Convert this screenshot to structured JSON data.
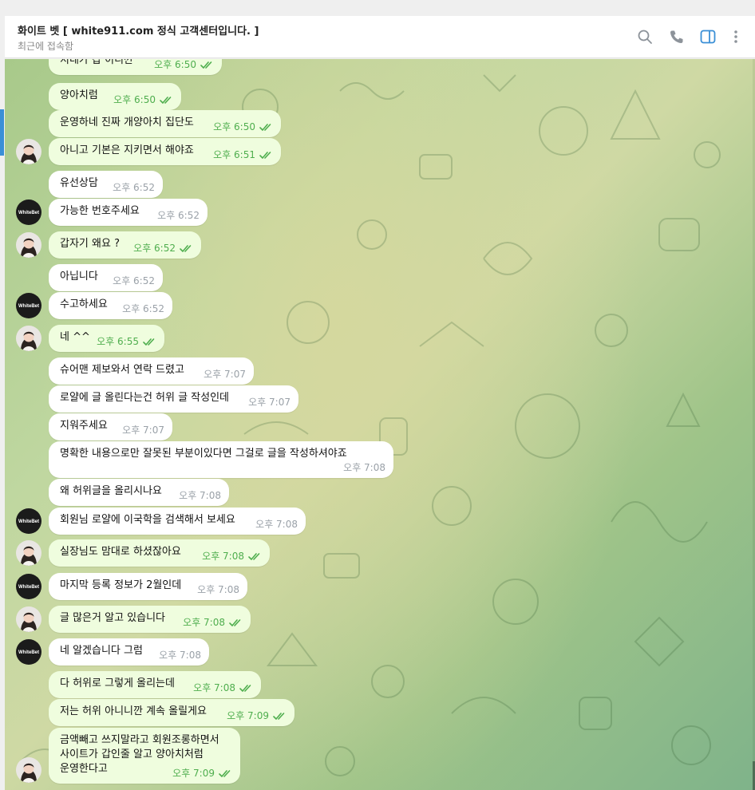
{
  "header": {
    "title": "화이트 벳 [ white911.com 정식 고객센터입니다. ]",
    "status": "최근에 접속함",
    "icons": [
      "search-icon",
      "phone-icon",
      "sidebar-toggle-icon",
      "more-icon"
    ]
  },
  "colors": {
    "accent": "#3a8fd6",
    "out_bubble": "#effdde",
    "in_bubble": "#ffffff",
    "read_tick": "#4fae4e"
  },
  "avatars": {
    "user": "woman-photo",
    "agent": "whitebet-logo"
  },
  "agent_logo_text": "WhiteBet",
  "messages": [
    {
      "text": "지네가 갑 이니깐",
      "time": "오후 6:50",
      "out": true
    },
    {
      "text": "양아치럼",
      "time": "오후 6:50",
      "out": true
    },
    {
      "text": "운영하네 진짜 개양아치 집단도",
      "time": "오후 6:50",
      "out": true
    },
    {
      "text": "아니고 기본은 지키면서 해야죠",
      "time": "오후 6:51",
      "out": true
    },
    {
      "text": "유선상담",
      "time": "오후 6:52",
      "out": false
    },
    {
      "text": "가능한 번호주세요",
      "time": "오후 6:52",
      "out": false
    },
    {
      "text": "갑자기 왜요 ?",
      "time": "오후 6:52",
      "out": true
    },
    {
      "text": "아닙니다",
      "time": "오후 6:52",
      "out": false
    },
    {
      "text": "수고하세요",
      "time": "오후 6:52",
      "out": false
    },
    {
      "text": "네 ^^",
      "time": "오후 6:55",
      "out": true
    },
    {
      "text": "슈어맨 제보와서 연락 드렸고",
      "time": "오후 7:07",
      "out": false
    },
    {
      "text": "로얄에 글 올린다는건 허위 글 작성인데",
      "time": "오후 7:07",
      "out": false
    },
    {
      "text": "지워주세요",
      "time": "오후 7:07",
      "out": false
    },
    {
      "text": "명확한 내용으로만 잘못된 부분이있다면 그걸로 글을 작성하셔야죠",
      "time": "오후 7:08",
      "out": false
    },
    {
      "text": "왜 허위글을 올리시나요",
      "time": "오후 7:08",
      "out": false
    },
    {
      "text": "회원님 로얄에 이국학을 검색해서 보세요",
      "time": "오후 7:08",
      "out": false
    },
    {
      "text": "실장님도 맘대로 하셨잖아요",
      "time": "오후 7:08",
      "out": true
    },
    {
      "text": "마지막 등록 정보가 2월인데",
      "time": "오후 7:08",
      "out": false
    },
    {
      "text": "글 많은거 알고 있습니다",
      "time": "오후 7:08",
      "out": true
    },
    {
      "text": "네 알겠습니다 그럼",
      "time": "오후 7:08",
      "out": false
    },
    {
      "text": "다 허위로 그렇게 올리는데",
      "time": "오후 7:08",
      "out": true
    },
    {
      "text": "저는 허위 아니니깐 계속 올릴게요",
      "time": "오후 7:09",
      "out": true
    },
    {
      "text": "금액빼고 쓰지말라고 회원조롱하면서\n사이트가 갑인줄 알고 양아치처럼\n운영한다고",
      "time": "오후 7:09",
      "out": true
    }
  ]
}
